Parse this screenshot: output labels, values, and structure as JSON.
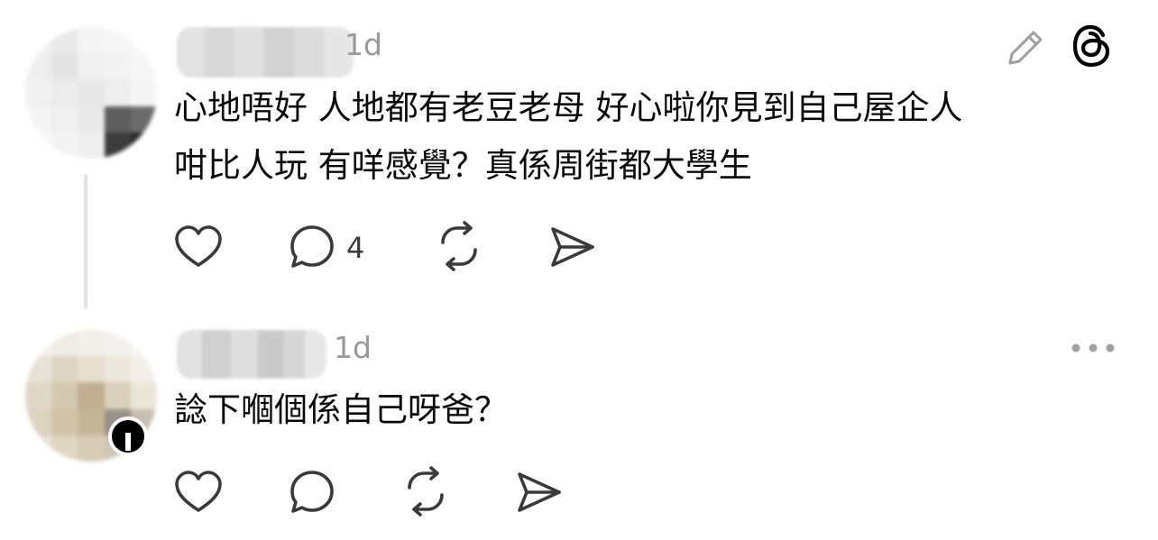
{
  "colors": {
    "background": "#ffffff",
    "text": "#0a0a0a",
    "muted": "#999999",
    "icon": "#3a3a3a",
    "thread_line": "#e3e3e3"
  },
  "posts": [
    {
      "time": "1d",
      "text_line1": "心地唔好 人地都有老豆老母 好心啦你見到自己屋企人",
      "text_line2": "咁比人玩 有咩感覺？真係周街都大學生",
      "reply_count": "4",
      "top_icons": [
        "edit-pencil-icon",
        "threads-logo-icon"
      ]
    },
    {
      "time": "1d",
      "text_line1": "諗下嗰個係自己呀爸？",
      "top_icons": [
        "more-options-icon"
      ]
    }
  ],
  "actions": [
    "like-heart-icon",
    "reply-bubble-icon",
    "repost-icon",
    "share-send-icon"
  ]
}
